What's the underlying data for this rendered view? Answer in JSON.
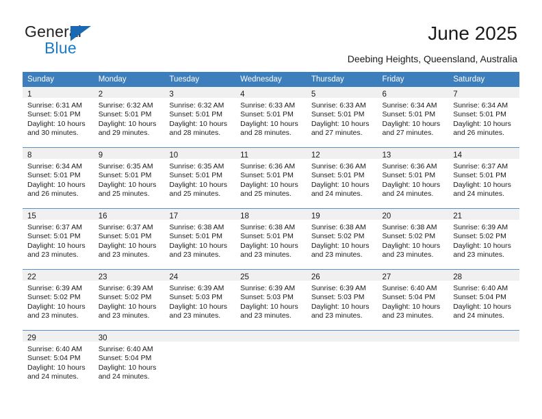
{
  "brand": {
    "name_part1": "General",
    "name_part2": "Blue",
    "triangle_color": "#1b69b2",
    "blue_color": "#1b79c7"
  },
  "header": {
    "title": "June 2025",
    "subtitle": "Deebing Heights, Queensland, Australia"
  },
  "calendar": {
    "header_bg": "#3d7ebd",
    "daynum_bg": "#f0f0f0",
    "weekday_headers": [
      "Sunday",
      "Monday",
      "Tuesday",
      "Wednesday",
      "Thursday",
      "Friday",
      "Saturday"
    ],
    "weeks": [
      [
        {
          "day": "1",
          "sunrise": "Sunrise: 6:31 AM",
          "sunset": "Sunset: 5:01 PM",
          "daylight_line1": "Daylight: 10 hours",
          "daylight_line2": "and 30 minutes."
        },
        {
          "day": "2",
          "sunrise": "Sunrise: 6:32 AM",
          "sunset": "Sunset: 5:01 PM",
          "daylight_line1": "Daylight: 10 hours",
          "daylight_line2": "and 29 minutes."
        },
        {
          "day": "3",
          "sunrise": "Sunrise: 6:32 AM",
          "sunset": "Sunset: 5:01 PM",
          "daylight_line1": "Daylight: 10 hours",
          "daylight_line2": "and 28 minutes."
        },
        {
          "day": "4",
          "sunrise": "Sunrise: 6:33 AM",
          "sunset": "Sunset: 5:01 PM",
          "daylight_line1": "Daylight: 10 hours",
          "daylight_line2": "and 28 minutes."
        },
        {
          "day": "5",
          "sunrise": "Sunrise: 6:33 AM",
          "sunset": "Sunset: 5:01 PM",
          "daylight_line1": "Daylight: 10 hours",
          "daylight_line2": "and 27 minutes."
        },
        {
          "day": "6",
          "sunrise": "Sunrise: 6:34 AM",
          "sunset": "Sunset: 5:01 PM",
          "daylight_line1": "Daylight: 10 hours",
          "daylight_line2": "and 27 minutes."
        },
        {
          "day": "7",
          "sunrise": "Sunrise: 6:34 AM",
          "sunset": "Sunset: 5:01 PM",
          "daylight_line1": "Daylight: 10 hours",
          "daylight_line2": "and 26 minutes."
        }
      ],
      [
        {
          "day": "8",
          "sunrise": "Sunrise: 6:34 AM",
          "sunset": "Sunset: 5:01 PM",
          "daylight_line1": "Daylight: 10 hours",
          "daylight_line2": "and 26 minutes."
        },
        {
          "day": "9",
          "sunrise": "Sunrise: 6:35 AM",
          "sunset": "Sunset: 5:01 PM",
          "daylight_line1": "Daylight: 10 hours",
          "daylight_line2": "and 25 minutes."
        },
        {
          "day": "10",
          "sunrise": "Sunrise: 6:35 AM",
          "sunset": "Sunset: 5:01 PM",
          "daylight_line1": "Daylight: 10 hours",
          "daylight_line2": "and 25 minutes."
        },
        {
          "day": "11",
          "sunrise": "Sunrise: 6:36 AM",
          "sunset": "Sunset: 5:01 PM",
          "daylight_line1": "Daylight: 10 hours",
          "daylight_line2": "and 25 minutes."
        },
        {
          "day": "12",
          "sunrise": "Sunrise: 6:36 AM",
          "sunset": "Sunset: 5:01 PM",
          "daylight_line1": "Daylight: 10 hours",
          "daylight_line2": "and 24 minutes."
        },
        {
          "day": "13",
          "sunrise": "Sunrise: 6:36 AM",
          "sunset": "Sunset: 5:01 PM",
          "daylight_line1": "Daylight: 10 hours",
          "daylight_line2": "and 24 minutes."
        },
        {
          "day": "14",
          "sunrise": "Sunrise: 6:37 AM",
          "sunset": "Sunset: 5:01 PM",
          "daylight_line1": "Daylight: 10 hours",
          "daylight_line2": "and 24 minutes."
        }
      ],
      [
        {
          "day": "15",
          "sunrise": "Sunrise: 6:37 AM",
          "sunset": "Sunset: 5:01 PM",
          "daylight_line1": "Daylight: 10 hours",
          "daylight_line2": "and 23 minutes."
        },
        {
          "day": "16",
          "sunrise": "Sunrise: 6:37 AM",
          "sunset": "Sunset: 5:01 PM",
          "daylight_line1": "Daylight: 10 hours",
          "daylight_line2": "and 23 minutes."
        },
        {
          "day": "17",
          "sunrise": "Sunrise: 6:38 AM",
          "sunset": "Sunset: 5:01 PM",
          "daylight_line1": "Daylight: 10 hours",
          "daylight_line2": "and 23 minutes."
        },
        {
          "day": "18",
          "sunrise": "Sunrise: 6:38 AM",
          "sunset": "Sunset: 5:01 PM",
          "daylight_line1": "Daylight: 10 hours",
          "daylight_line2": "and 23 minutes."
        },
        {
          "day": "19",
          "sunrise": "Sunrise: 6:38 AM",
          "sunset": "Sunset: 5:02 PM",
          "daylight_line1": "Daylight: 10 hours",
          "daylight_line2": "and 23 minutes."
        },
        {
          "day": "20",
          "sunrise": "Sunrise: 6:38 AM",
          "sunset": "Sunset: 5:02 PM",
          "daylight_line1": "Daylight: 10 hours",
          "daylight_line2": "and 23 minutes."
        },
        {
          "day": "21",
          "sunrise": "Sunrise: 6:39 AM",
          "sunset": "Sunset: 5:02 PM",
          "daylight_line1": "Daylight: 10 hours",
          "daylight_line2": "and 23 minutes."
        }
      ],
      [
        {
          "day": "22",
          "sunrise": "Sunrise: 6:39 AM",
          "sunset": "Sunset: 5:02 PM",
          "daylight_line1": "Daylight: 10 hours",
          "daylight_line2": "and 23 minutes."
        },
        {
          "day": "23",
          "sunrise": "Sunrise: 6:39 AM",
          "sunset": "Sunset: 5:02 PM",
          "daylight_line1": "Daylight: 10 hours",
          "daylight_line2": "and 23 minutes."
        },
        {
          "day": "24",
          "sunrise": "Sunrise: 6:39 AM",
          "sunset": "Sunset: 5:03 PM",
          "daylight_line1": "Daylight: 10 hours",
          "daylight_line2": "and 23 minutes."
        },
        {
          "day": "25",
          "sunrise": "Sunrise: 6:39 AM",
          "sunset": "Sunset: 5:03 PM",
          "daylight_line1": "Daylight: 10 hours",
          "daylight_line2": "and 23 minutes."
        },
        {
          "day": "26",
          "sunrise": "Sunrise: 6:39 AM",
          "sunset": "Sunset: 5:03 PM",
          "daylight_line1": "Daylight: 10 hours",
          "daylight_line2": "and 23 minutes."
        },
        {
          "day": "27",
          "sunrise": "Sunrise: 6:40 AM",
          "sunset": "Sunset: 5:04 PM",
          "daylight_line1": "Daylight: 10 hours",
          "daylight_line2": "and 23 minutes."
        },
        {
          "day": "28",
          "sunrise": "Sunrise: 6:40 AM",
          "sunset": "Sunset: 5:04 PM",
          "daylight_line1": "Daylight: 10 hours",
          "daylight_line2": "and 24 minutes."
        }
      ],
      [
        {
          "day": "29",
          "sunrise": "Sunrise: 6:40 AM",
          "sunset": "Sunset: 5:04 PM",
          "daylight_line1": "Daylight: 10 hours",
          "daylight_line2": "and 24 minutes."
        },
        {
          "day": "30",
          "sunrise": "Sunrise: 6:40 AM",
          "sunset": "Sunset: 5:04 PM",
          "daylight_line1": "Daylight: 10 hours",
          "daylight_line2": "and 24 minutes."
        },
        {
          "day": "",
          "sunrise": "",
          "sunset": "",
          "daylight_line1": "",
          "daylight_line2": ""
        },
        {
          "day": "",
          "sunrise": "",
          "sunset": "",
          "daylight_line1": "",
          "daylight_line2": ""
        },
        {
          "day": "",
          "sunrise": "",
          "sunset": "",
          "daylight_line1": "",
          "daylight_line2": ""
        },
        {
          "day": "",
          "sunrise": "",
          "sunset": "",
          "daylight_line1": "",
          "daylight_line2": ""
        },
        {
          "day": "",
          "sunrise": "",
          "sunset": "",
          "daylight_line1": "",
          "daylight_line2": ""
        }
      ]
    ]
  }
}
